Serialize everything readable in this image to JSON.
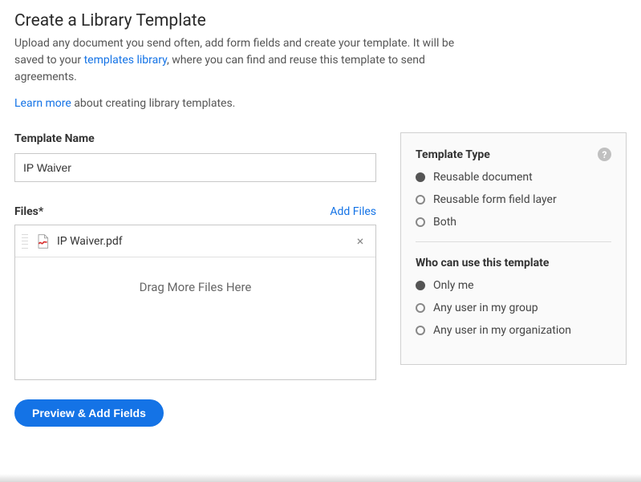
{
  "header": {
    "title": "Create a Library Template",
    "intro_before_link": "Upload any document you send often, add form fields and create your template. It will be saved to your ",
    "intro_link": "templates library",
    "intro_after_link": ", where you can find and reuse this template to send agreements.",
    "learn_more_link": "Learn more",
    "learn_more_suffix": " about creating library templates."
  },
  "template_name": {
    "label": "Template Name",
    "value": "IP Waiver"
  },
  "files": {
    "label": "Files",
    "required_mark": "*",
    "add_files": "Add Files",
    "items": [
      {
        "name": "IP Waiver.pdf"
      }
    ],
    "drop_text": "Drag More Files Here"
  },
  "type_section": {
    "title": "Template Type",
    "options": [
      {
        "label": "Reusable document",
        "selected": true
      },
      {
        "label": "Reusable form field layer",
        "selected": false
      },
      {
        "label": "Both",
        "selected": false
      }
    ]
  },
  "access_section": {
    "title": "Who can use this template",
    "options": [
      {
        "label": "Only me",
        "selected": true
      },
      {
        "label": "Any user in my group",
        "selected": false
      },
      {
        "label": "Any user in my organization",
        "selected": false
      }
    ]
  },
  "primary_button": "Preview & Add Fields"
}
